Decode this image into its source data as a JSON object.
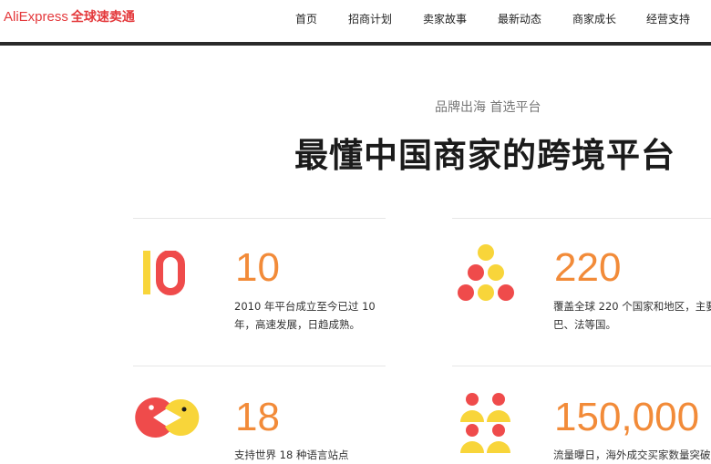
{
  "header": {
    "logo_text": "AliExpress",
    "logo_cn": "全球速卖通",
    "nav": [
      "首页",
      "招商计划",
      "卖家故事",
      "最新动态",
      "商家成长",
      "经营支持"
    ]
  },
  "hero": {
    "subtitle": "品牌出海 首选平台",
    "title": "最懂中国商家的跨境平台"
  },
  "stats": [
    {
      "icon": "ten-years-icon",
      "number": "10",
      "desc": "2010 年平台成立至今已过 10 年，高速发展，日趋成熟。"
    },
    {
      "icon": "dots-pyramid-icon",
      "number": "220",
      "desc": "覆盖全球 220 个国家和地区，主要巴、法等国。"
    },
    {
      "icon": "chat-pacman-icon",
      "number": "18",
      "desc": "支持世界 18 种语言站点"
    },
    {
      "icon": "people-icon",
      "number": "150,000",
      "desc": "流量曝日，海外成交买家数量突破"
    }
  ],
  "colors": {
    "brand": "#e4393c",
    "accent": "#f28b39",
    "red_dot": "#ef4b4b",
    "yellow_dot": "#f8d53a"
  }
}
